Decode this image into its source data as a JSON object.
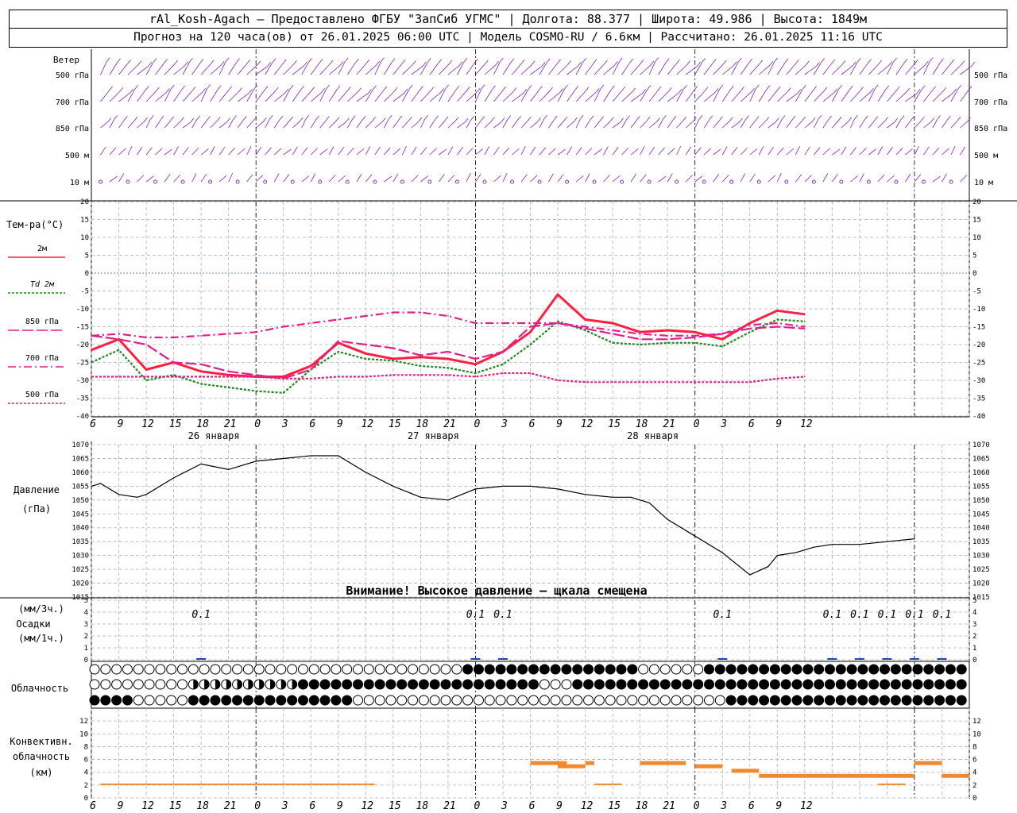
{
  "header": {
    "line1": "rAl_Kosh-Agach — Предоставлено ФГБУ \"ЗапСиб УГМС\" | Долгота: 88.377 | Широта: 49.986 | Высота: 1849м",
    "line2": "Прогноз на 120 часа(ов) от 26.01.2025 06:00 UTC | Модель COSMO-RU / 6.6км | Рассчитано: 26.01.2025 11:16 UTC"
  },
  "panels": {
    "wind": {
      "title": "Ветер",
      "levels": [
        "500 гПа",
        "700 гПа",
        "850 гПа",
        "500 м",
        "10 м"
      ]
    },
    "temp": {
      "title": "Тем-ра(°C)",
      "legend": [
        {
          "label": "2м",
          "color": "#ff2040",
          "dash": ""
        },
        {
          "label": "Td 2м",
          "color": "#1a8a1a",
          "dash": "3,2"
        },
        {
          "label": "850 гПа",
          "color": "#e0208a",
          "dash": "14,4"
        },
        {
          "label": "700 гПа",
          "color": "#e0208a",
          "dash": "10,4,2,4"
        },
        {
          "label": "500 гПа",
          "color": "#e0208a",
          "dash": "3,2"
        }
      ]
    },
    "pressure": {
      "title": "Давление",
      "unit": "(гПа)",
      "warning": "Внимание! Высокое давление — щкала смещена"
    },
    "precip": {
      "unit_top": "(мм/3ч.)",
      "title": "Осадки",
      "unit_bottom": "(мм/1ч.)"
    },
    "cloud": {
      "title": "Облачность"
    },
    "conv": {
      "title_1": "Конвективн.",
      "title_2": "облачность",
      "unit": "(км)"
    }
  },
  "time_axis": {
    "hours": [
      6,
      9,
      12,
      15,
      18,
      21,
      0,
      3,
      6,
      9,
      12,
      15,
      18,
      21,
      0,
      3,
      6,
      9,
      12,
      15,
      18,
      21,
      0,
      3,
      6,
      9,
      12
    ],
    "dates": [
      {
        "label": "26 января",
        "at_hour": 12
      },
      {
        "label": "27 января",
        "at_hour": 36
      },
      {
        "label": "28 января",
        "at_hour": 60
      }
    ]
  },
  "chart_data": [
    {
      "type": "line",
      "title": "Тем-ра(°C)",
      "x_hours_from_start": [
        0,
        3,
        6,
        9,
        12,
        15,
        18,
        21,
        24,
        27,
        30,
        33,
        36,
        39,
        42,
        45,
        48,
        51,
        54,
        57,
        60,
        63,
        66,
        69,
        72,
        75,
        78
      ],
      "ylim": [
        -40,
        20
      ],
      "yticks": [
        -40,
        -35,
        -30,
        -25,
        -20,
        -15,
        -10,
        -5,
        0,
        5,
        10,
        15,
        20
      ],
      "series": [
        {
          "name": "2м",
          "color": "#ff2040",
          "values": [
            -21.5,
            -18.5,
            -27,
            -25,
            -27.5,
            -28.5,
            -29,
            -29,
            -26,
            -19.5,
            -22.5,
            -24,
            -23.5,
            -24,
            -25.5,
            -22,
            -16.5,
            -6,
            -13,
            -14,
            -16.5,
            -16,
            -16.5,
            -18.5,
            -14,
            -10.5,
            -11.5
          ]
        },
        {
          "name": "Td 2м",
          "color": "#1a8a1a",
          "values": [
            -25,
            -21.5,
            -30,
            -28.5,
            -31,
            -32,
            -33,
            -33.5,
            -27,
            -22,
            -24,
            -24.5,
            -26,
            -26.5,
            -28,
            -25.5,
            -20,
            -13.5,
            -16,
            -19.5,
            -20,
            -19.5,
            -19.5,
            -20.5,
            -16.5,
            -13,
            -13.5
          ]
        },
        {
          "name": "850 гПа",
          "color": "#e0208a",
          "values": [
            -17.5,
            -18.5,
            -20,
            -25,
            -25.5,
            -27.5,
            -28.5,
            -29.5,
            -27,
            -19,
            -20,
            -21,
            -23,
            -22,
            -24,
            -22,
            -15,
            -14,
            -15.5,
            -17,
            -18.5,
            -18.5,
            -18,
            -17,
            -15.5,
            -15,
            -15.5
          ]
        },
        {
          "name": "700 гПа",
          "color": "#e0208a",
          "values": [
            -17.5,
            -17,
            -18,
            -18,
            -17.5,
            -17,
            -16.5,
            -15,
            -14,
            -13,
            -12,
            -11,
            -11,
            -12,
            -14,
            -14,
            -14,
            -14,
            -15,
            -16,
            -17,
            -17.5,
            -17.5,
            -17,
            -14.5,
            -14,
            -15
          ]
        },
        {
          "name": "500 гПа",
          "color": "#e0208a",
          "values": [
            -29,
            -29,
            -29,
            -29,
            -29,
            -29,
            -29,
            -29.5,
            -29.5,
            -29,
            -29,
            -28.5,
            -28.5,
            -28.5,
            -29,
            -28,
            -28,
            -30,
            -30.5,
            -30.5,
            -30.5,
            -30.5,
            -30.5,
            -30.5,
            -30.5,
            -29.5,
            -29
          ]
        }
      ]
    },
    {
      "type": "line",
      "title": "Давление",
      "x_hours_from_start": [
        0,
        1,
        3,
        5,
        6,
        9,
        12,
        15,
        18,
        21,
        24,
        27,
        30,
        33,
        36,
        39,
        42,
        45,
        48,
        51,
        54,
        57,
        59,
        60,
        61,
        63,
        66,
        69,
        72,
        74,
        75,
        77,
        79,
        81,
        84,
        87,
        90
      ],
      "ylim": [
        1015,
        1070
      ],
      "yticks": [
        1015,
        1020,
        1025,
        1030,
        1035,
        1040,
        1045,
        1050,
        1055,
        1060,
        1065,
        1070
      ],
      "series": [
        {
          "name": "",
          "color": "#000000",
          "values": [
            1055,
            1056,
            1052,
            1051,
            1052,
            1058,
            1063,
            1061,
            1064,
            1065,
            1066,
            1066,
            1060,
            1055,
            1051,
            1050,
            1054,
            1055,
            1055,
            1054,
            1052,
            1051,
            1051,
            1050,
            1049,
            1043,
            1037,
            1031,
            1023,
            1026,
            1030,
            1031,
            1033,
            1034,
            1034,
            1035,
            1036
          ]
        }
      ]
    }
  ],
  "precip_labels": [
    {
      "hour": 12,
      "text": "0.1"
    },
    {
      "hour": 42,
      "text": "0.1"
    },
    {
      "hour": 45,
      "text": "0.1"
    },
    {
      "hour": 69,
      "text": "0.1"
    },
    {
      "hour": 81,
      "text": "0.1"
    },
    {
      "hour": 84,
      "text": "0.1"
    },
    {
      "hour": 87,
      "text": "0.1"
    },
    {
      "hour": 90,
      "text": "0.1"
    },
    {
      "hour": 93,
      "text": "0.1"
    }
  ]
}
